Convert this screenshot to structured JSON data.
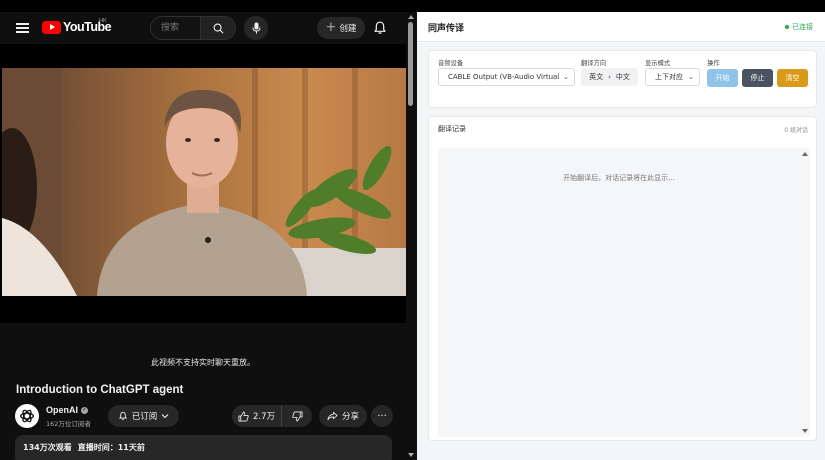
{
  "youtube": {
    "logo_text": "YouTube",
    "region": "HK",
    "search_placeholder": "搜索",
    "create_label": "创建",
    "chat_replay_notice": "此视频不支持实时聊天重放。",
    "video_title": "Introduction to ChatGPT agent",
    "channel_name": "OpenAI",
    "subscriber_count": "162万位订阅者",
    "subscribed_label": "已订阅",
    "like_count": "2.7万",
    "share_label": "分享",
    "more_label": "···",
    "views": "134万次观看",
    "premiere": "直播时间：11天前"
  },
  "interpreter": {
    "title": "同声传译",
    "status": "已连接",
    "audio_device_label": "音频设备",
    "audio_device_value": "CABLE Output (VB-Audio Virtual",
    "direction_label": "翻译方向",
    "source_lang": "英文",
    "direction_arrow": "›",
    "target_lang": "中文",
    "display_mode_label": "显示模式",
    "display_mode_value": "上下对应",
    "actions_label": "操作",
    "start_label": "开始",
    "stop_label": "停止",
    "clear_label": "清空",
    "records_title": "翻译记录",
    "records_count": "0 组对话",
    "empty_hint": "开始翻译后，对话记录将在此显示..."
  },
  "colors": {
    "youtube_red": "#ff0000",
    "status_green": "#2ea84f",
    "start_button": "#8fc3ea",
    "stop_button": "#4a5361",
    "clear_button": "#d99a17"
  }
}
